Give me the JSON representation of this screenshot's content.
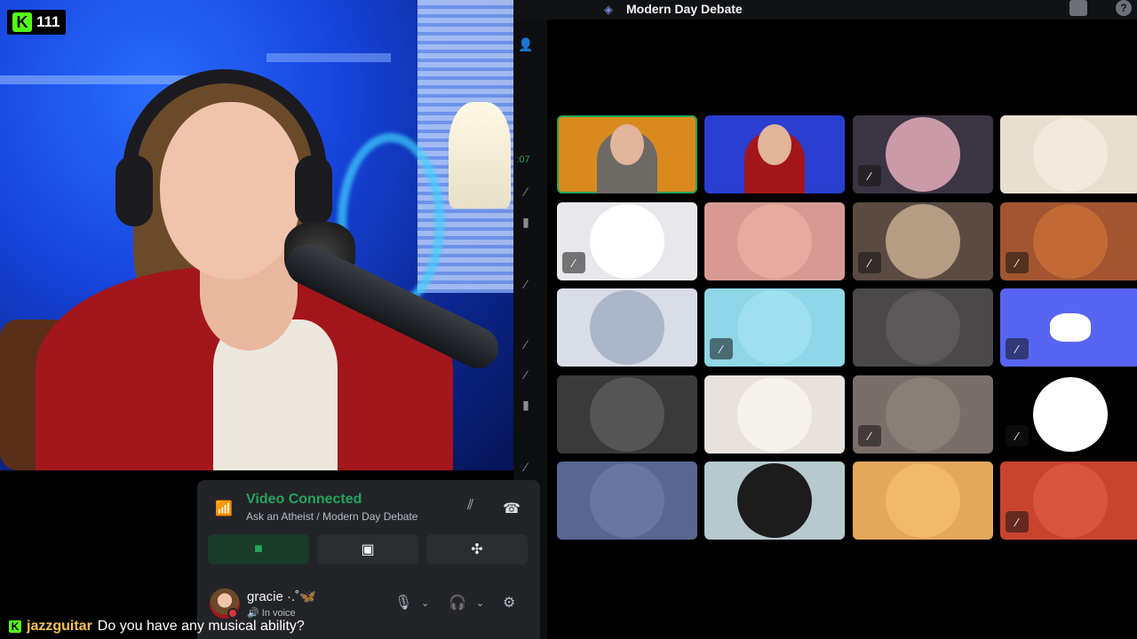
{
  "stream": {
    "viewer_count": "111",
    "platform_icon": "kick-logo"
  },
  "discord": {
    "channel_title": "Modern Day Debate",
    "voice": {
      "status": "Video Connected",
      "location": "Ask an Atheist / Modern Day Debate"
    },
    "user": {
      "name": "gracie ·.˚🦋",
      "status": "In voice"
    },
    "strip_timestamp": ":07"
  },
  "participants": [
    {
      "id": "p1",
      "muted": false,
      "speaking": true,
      "kind": "video",
      "bg": "#d98a1f"
    },
    {
      "id": "p2",
      "muted": false,
      "speaking": false,
      "kind": "video",
      "bg": "#2a3fd0"
    },
    {
      "id": "p3",
      "muted": true,
      "speaking": false,
      "kind": "avatar",
      "bg": "#3b3442",
      "av": "#c99aa8"
    },
    {
      "id": "p4",
      "muted": false,
      "speaking": false,
      "kind": "avatar",
      "bg": "#e8dfcf",
      "av": "#f1eadd"
    },
    {
      "id": "p5",
      "muted": true,
      "speaking": false,
      "kind": "avatar",
      "bg": "#e8e8ec",
      "av": "#ffffff"
    },
    {
      "id": "p6",
      "muted": false,
      "speaking": false,
      "kind": "avatar",
      "bg": "#d79a93",
      "av": "#e7aaa0"
    },
    {
      "id": "p7",
      "muted": true,
      "speaking": false,
      "kind": "avatar",
      "bg": "#5a4a42",
      "av": "#b49d84"
    },
    {
      "id": "p8",
      "muted": true,
      "speaking": false,
      "kind": "avatar",
      "bg": "#a2552f",
      "av": "#c26a36"
    },
    {
      "id": "p9",
      "muted": false,
      "speaking": false,
      "kind": "avatar",
      "bg": "#d9dde6",
      "av": "#aab7c9"
    },
    {
      "id": "p10",
      "muted": true,
      "speaking": false,
      "kind": "avatar",
      "bg": "#8fd6e6",
      "av": "#9fe0ee"
    },
    {
      "id": "p11",
      "muted": false,
      "speaking": false,
      "kind": "avatar",
      "bg": "#4a4848",
      "av": "#5a5858"
    },
    {
      "id": "p12",
      "muted": true,
      "speaking": false,
      "kind": "discord",
      "bg": "#5865f2",
      "av": "#5865f2"
    },
    {
      "id": "p13",
      "muted": false,
      "speaking": false,
      "kind": "avatar",
      "bg": "#3a3a3a",
      "av": "#555"
    },
    {
      "id": "p14",
      "muted": false,
      "speaking": false,
      "kind": "avatar",
      "bg": "#e8e2dc",
      "av": "#f5f1ec"
    },
    {
      "id": "p15",
      "muted": true,
      "speaking": false,
      "kind": "avatar",
      "bg": "#7a6e6a",
      "av": "#8a7e78"
    },
    {
      "id": "p16",
      "muted": true,
      "speaking": false,
      "kind": "avatar",
      "bg": "#000000",
      "av": "#ffffff"
    },
    {
      "id": "p17",
      "muted": false,
      "speaking": false,
      "kind": "avatar",
      "bg": "#5a6690",
      "av": "#6a76a0"
    },
    {
      "id": "p18",
      "muted": false,
      "speaking": false,
      "kind": "avatar",
      "bg": "#b6c9cf",
      "av": "#1c1c1c"
    },
    {
      "id": "p19",
      "muted": false,
      "speaking": false,
      "kind": "avatar",
      "bg": "#e3a85c",
      "av": "#f0b96a"
    },
    {
      "id": "p20",
      "muted": true,
      "speaking": false,
      "kind": "avatar",
      "bg": "#c9442e",
      "av": "#d9553d"
    }
  ],
  "chat": {
    "username": "jazzguitar",
    "message": "Do you have any musical ability?"
  },
  "colors": {
    "green": "#23a55a",
    "kick_green": "#53fc18",
    "discord_blurple": "#5865f2"
  }
}
